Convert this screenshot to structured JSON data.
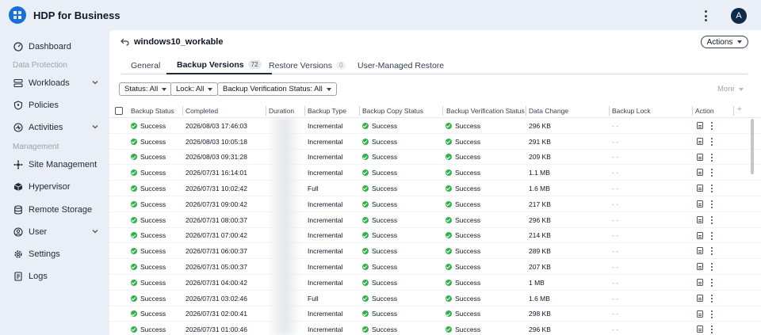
{
  "app": {
    "title": "HDP for Business",
    "avatar_letter": "A"
  },
  "sidebar": {
    "items": [
      {
        "label": "Dashboard",
        "icon": "gauge-icon"
      },
      {
        "label": "Workloads",
        "icon": "stack-icon",
        "expandable": true
      },
      {
        "label": "Policies",
        "icon": "shield-icon"
      },
      {
        "label": "Activities",
        "icon": "activity-icon",
        "expandable": true
      },
      {
        "label": "Site Management",
        "icon": "network-icon"
      },
      {
        "label": "Hypervisor",
        "icon": "cube-icon"
      },
      {
        "label": "Remote Storage",
        "icon": "database-icon"
      },
      {
        "label": "User",
        "icon": "user-icon",
        "expandable": true
      },
      {
        "label": "Settings",
        "icon": "gear-icon"
      },
      {
        "label": "Logs",
        "icon": "log-icon"
      }
    ],
    "sections": {
      "data_protection": "Data Protection",
      "management": "Management"
    }
  },
  "page": {
    "title": "windows10_workable",
    "actions_label": "Actions",
    "tabs": [
      {
        "label": "General"
      },
      {
        "label": "Backup Versions",
        "count": "72"
      },
      {
        "label": "Restore Versions",
        "count": "0"
      },
      {
        "label": "User-Managed Restore"
      }
    ],
    "filters": {
      "status": "Status: All",
      "lock": "Lock: All",
      "verification": "Backup Verification Status: All"
    },
    "more_label": "More"
  },
  "table": {
    "columns": [
      "Backup Status",
      "Completed",
      "Duration",
      "Backup Type",
      "Backup Copy Status",
      "Backup Verification Status",
      "Data Change",
      "Backup Lock",
      "Action"
    ],
    "rows": [
      {
        "status": "Success",
        "completed": "2026/08/03 17:46:03",
        "type": "Incremental",
        "copy": "Success",
        "verify": "Success",
        "change": "296 KB",
        "lock": "- -"
      },
      {
        "status": "Success",
        "completed": "2026/08/03 10:05:18",
        "type": "Incremental",
        "copy": "Success",
        "verify": "Success",
        "change": "291 KB",
        "lock": "- -"
      },
      {
        "status": "Success",
        "completed": "2026/08/03 09:31:28",
        "type": "Incremental",
        "copy": "Success",
        "verify": "Success",
        "change": "209 KB",
        "lock": "- -"
      },
      {
        "status": "Success",
        "completed": "2026/07/31 16:14:01",
        "type": "Incremental",
        "copy": "Success",
        "verify": "Success",
        "change": "1.1 MB",
        "lock": "- -"
      },
      {
        "status": "Success",
        "completed": "2026/07/31 10:02:42",
        "type": "Full",
        "copy": "Success",
        "verify": "Success",
        "change": "1.6 MB",
        "lock": "- -"
      },
      {
        "status": "Success",
        "completed": "2026/07/31 09:00:42",
        "type": "Incremental",
        "copy": "Success",
        "verify": "Success",
        "change": "217 KB",
        "lock": "- -"
      },
      {
        "status": "Success",
        "completed": "2026/07/31 08:00:37",
        "type": "Incremental",
        "copy": "Success",
        "verify": "Success",
        "change": "296 KB",
        "lock": "- -"
      },
      {
        "status": "Success",
        "completed": "2026/07/31 07:00:42",
        "type": "Incremental",
        "copy": "Success",
        "verify": "Success",
        "change": "214 KB",
        "lock": "- -"
      },
      {
        "status": "Success",
        "completed": "2026/07/31 06:00:37",
        "type": "Incremental",
        "copy": "Success",
        "verify": "Success",
        "change": "289 KB",
        "lock": "- -"
      },
      {
        "status": "Success",
        "completed": "2026/07/31 05:00:37",
        "type": "Incremental",
        "copy": "Success",
        "verify": "Success",
        "change": "207 KB",
        "lock": "- -"
      },
      {
        "status": "Success",
        "completed": "2026/07/31 04:00:42",
        "type": "Incremental",
        "copy": "Success",
        "verify": "Success",
        "change": "1 MB",
        "lock": "- -"
      },
      {
        "status": "Success",
        "completed": "2026/07/31 03:02:46",
        "type": "Full",
        "copy": "Success",
        "verify": "Success",
        "change": "1.6 MB",
        "lock": "- -"
      },
      {
        "status": "Success",
        "completed": "2026/07/31 02:00:41",
        "type": "Incremental",
        "copy": "Success",
        "verify": "Success",
        "change": "298 KB",
        "lock": "- -"
      },
      {
        "status": "Success",
        "completed": "2026/07/31 01:00:46",
        "type": "Incremental",
        "copy": "Success",
        "verify": "Success",
        "change": "296 KB",
        "lock": "- -"
      }
    ]
  },
  "colors": {
    "accent": "#1a6fd6",
    "success": "#34b24a",
    "sidebar_bg": "#e9eef7"
  }
}
